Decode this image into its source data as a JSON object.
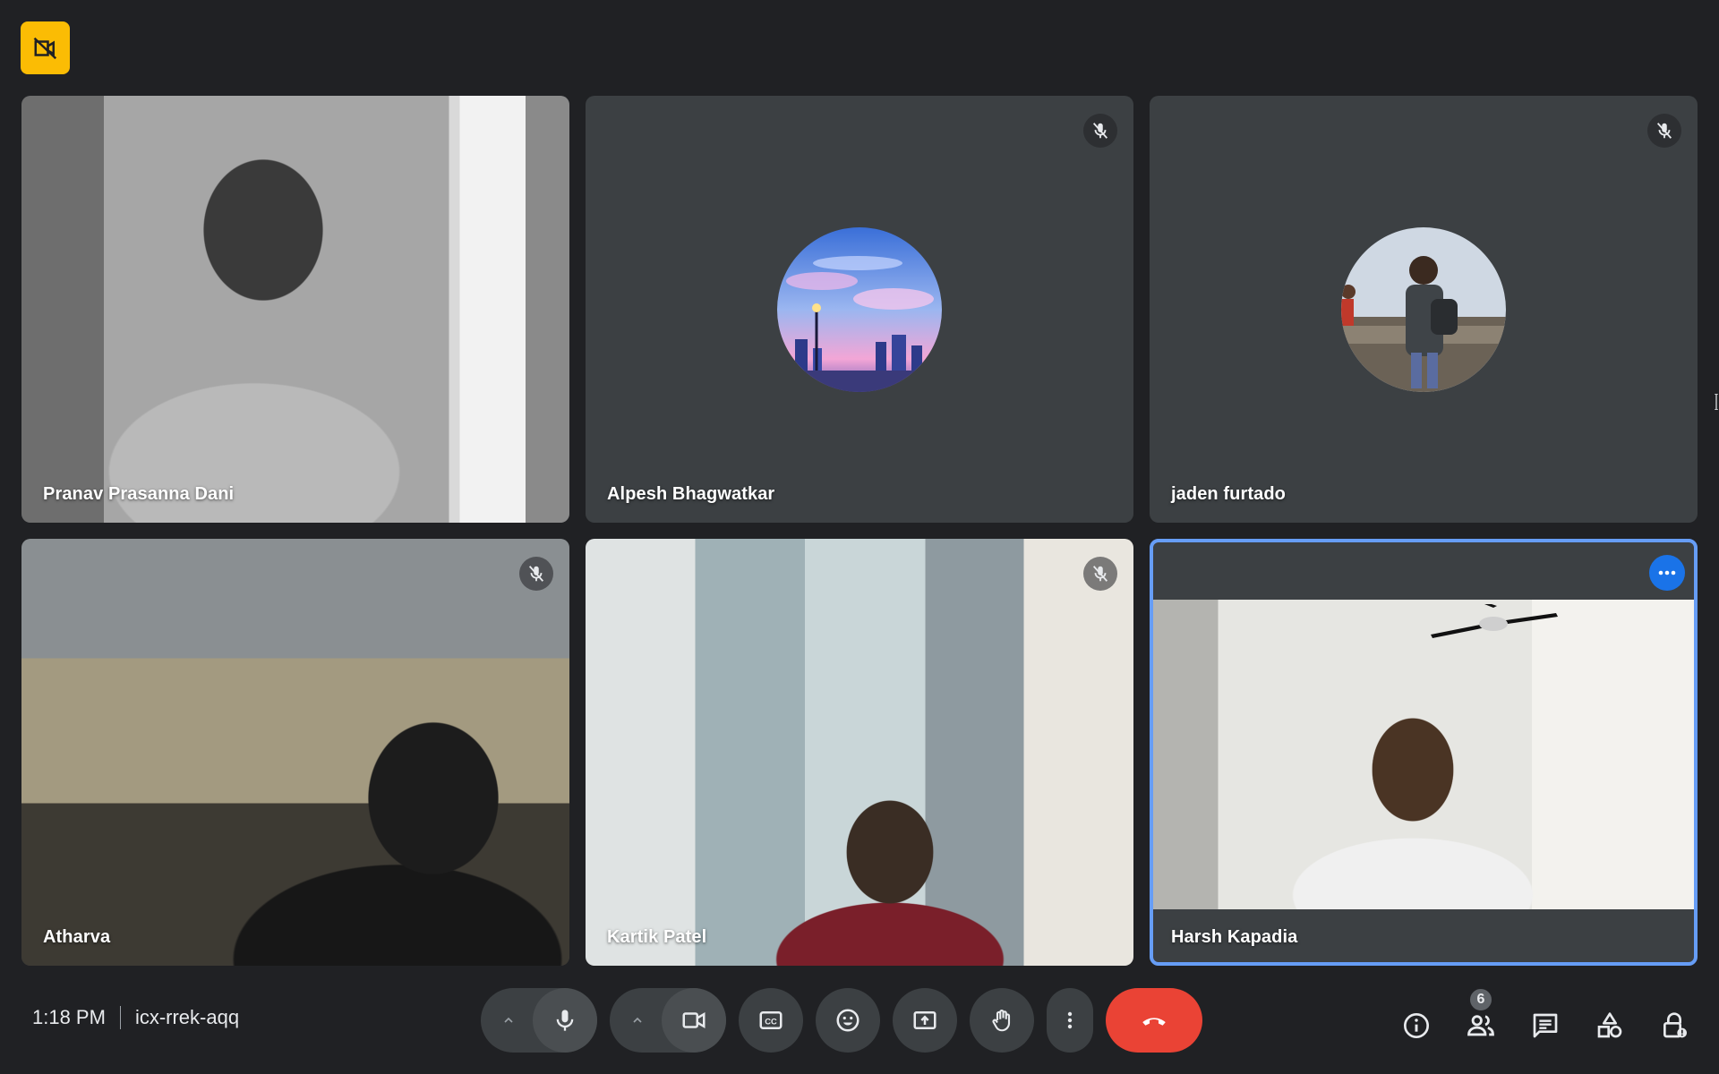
{
  "meeting": {
    "time": "1:18 PM",
    "code": "icx-rrek-aqq"
  },
  "participants_count": "6",
  "tiles": [
    {
      "name": "Pranav Prasanna Dani"
    },
    {
      "name": "Alpesh Bhagwatkar"
    },
    {
      "name": "jaden furtado"
    },
    {
      "name": "Atharva"
    },
    {
      "name": "Kartik Patel"
    },
    {
      "name": "Harsh Kapadia"
    }
  ],
  "icons": {
    "top_badge": "video-off-icon",
    "mute": "mic-off-icon",
    "tile_more": "more-horizontal-icon",
    "mic": "mic-icon",
    "camera": "camera-icon",
    "captions": "captions-icon",
    "emoji": "emoji-icon",
    "present": "present-screen-icon",
    "raise_hand": "raise-hand-icon",
    "more_options": "more-vertical-icon",
    "leave_call": "leave-call-icon",
    "info": "info-icon",
    "people": "people-icon",
    "chat": "chat-icon",
    "activities": "activities-icon",
    "host_controls": "lock-icon"
  },
  "colors": {
    "background": "#202124",
    "tile": "#3c4043",
    "end_call": "#ea4335",
    "accent_blue": "#1a73e8",
    "badge_yellow": "#fbbc04",
    "active_outline": "#669df6"
  }
}
